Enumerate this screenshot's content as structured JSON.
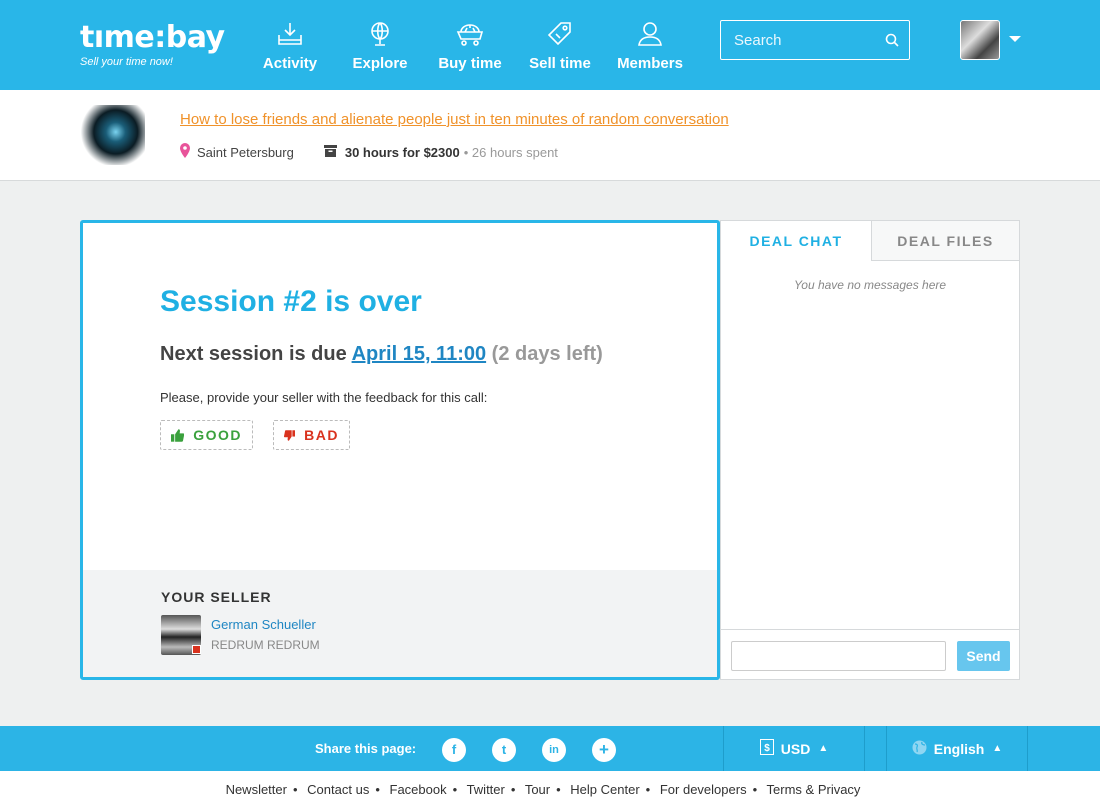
{
  "header": {
    "logo": "tıme:bay",
    "tagline": "Sell your time now!",
    "nav": [
      {
        "label": "Activity",
        "icon": "inbox-download-icon"
      },
      {
        "label": "Explore",
        "icon": "globe-icon"
      },
      {
        "label": "Buy time",
        "icon": "cart-icon"
      },
      {
        "label": "Sell time",
        "icon": "price-tag-icon"
      },
      {
        "label": "Members",
        "icon": "user-icon"
      }
    ],
    "search_placeholder": "Search"
  },
  "project": {
    "title": "How to lose friends and alienate people just in ten minutes of random conversation",
    "location": "Saint Petersburg",
    "hours": "30 hours for $2300",
    "spent": "26 hours spent"
  },
  "session": {
    "title": "Session #2 is over",
    "next_prefix": "Next session is due",
    "next_date": "April 15, 11:00",
    "next_left": "(2 days left)",
    "feedback_prompt": "Please, provide your seller with the feedback for this call:",
    "good_label": "GOOD",
    "bad_label": "BAD"
  },
  "seller": {
    "heading": "YOUR SELLER",
    "name": "German Schueller",
    "subtitle": "REDRUM REDRUM"
  },
  "chat": {
    "tab_chat": "DEAL CHAT",
    "tab_files": "DEAL FILES",
    "empty": "You have no messages here",
    "send_label": "Send"
  },
  "share": {
    "label": "Share this page:",
    "networks": [
      "f",
      "t",
      "in",
      "+"
    ],
    "currency": "USD",
    "language": "English"
  },
  "footer": {
    "links": [
      "Newsletter",
      "Contact us",
      "Facebook",
      "Twitter",
      "Tour",
      "Help Center",
      "For developers",
      "Terms & Privacy"
    ]
  },
  "colors": {
    "brand": "#29b6e8",
    "link": "#1f86c3",
    "accent_orange": "#f0922a",
    "good": "#3aa13d",
    "bad": "#d9321e"
  }
}
